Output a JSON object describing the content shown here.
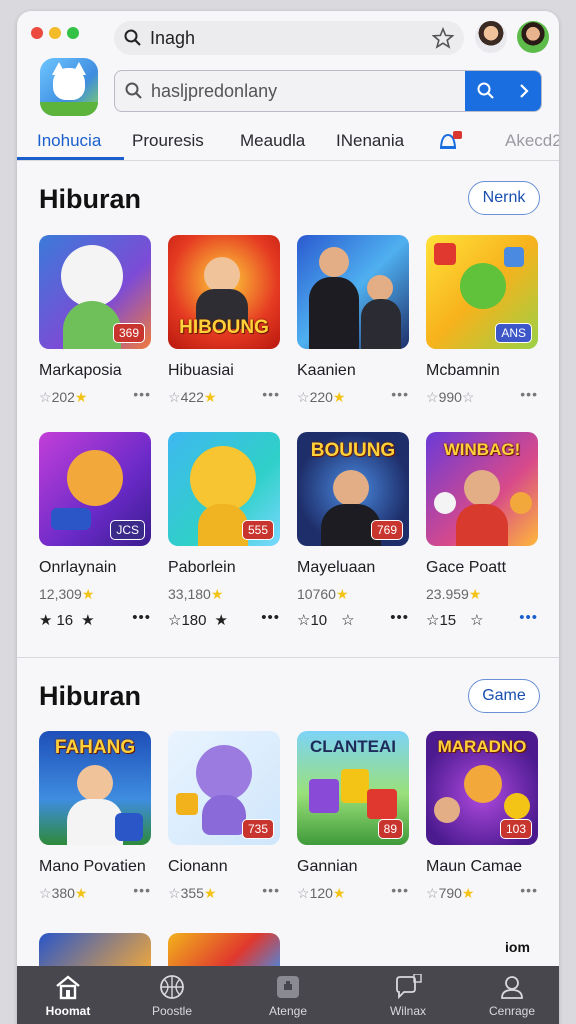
{
  "top": {
    "search_query": "Inagh",
    "main_search_placeholder": "hasljpredonlany"
  },
  "tabs": [
    {
      "label": "Inohucia",
      "active": true
    },
    {
      "label": "Prouresis"
    },
    {
      "label": "Meaudla"
    },
    {
      "label": "INenania"
    },
    {
      "label": "Akecd2",
      "faded": true
    }
  ],
  "sections": [
    {
      "title": "Hiburan",
      "action_label": "Nernk",
      "rows": [
        [
          {
            "name": "Markaposia",
            "rating": "202",
            "badge": "369"
          },
          {
            "name": "Hibuasiai",
            "rating": "422",
            "banner": "HIBOUNG"
          },
          {
            "name": "Kaanien",
            "rating": "220"
          },
          {
            "name": "Mcbamnin",
            "rating": "990",
            "badge": "ANS"
          }
        ],
        [
          {
            "name": "Onrlaynain",
            "rating": "12,309",
            "badge": "JCS",
            "sub": "16"
          },
          {
            "name": "Paborlein",
            "rating": "33,180",
            "badge": "555",
            "sub": "180"
          },
          {
            "name": "Mayeluaan",
            "rating": "10760",
            "badge": "769",
            "banner": "BOUUNG",
            "sub": "10"
          },
          {
            "name": "Gace Poatt",
            "rating": "23.959",
            "banner": "WINBAG!",
            "sub": "15"
          }
        ]
      ]
    },
    {
      "title": "Hiburan",
      "action_label": "Game",
      "rows": [
        [
          {
            "name": "Mano Povatien",
            "rating": "380",
            "banner": "FAHANG"
          },
          {
            "name": "Cionann",
            "rating": "355",
            "badge": "735"
          },
          {
            "name": "Gannian",
            "rating": "120",
            "banner": "CLANTEAI",
            "badge": "89"
          },
          {
            "name": "Maun Camae",
            "rating": "790",
            "banner": "MARADNO",
            "badge": "103"
          }
        ]
      ]
    }
  ],
  "footer_text": "iom",
  "bottom_nav": [
    {
      "label": "Hoomat",
      "icon": "home-icon",
      "active": true
    },
    {
      "label": "Poostle",
      "icon": "basketball-icon"
    },
    {
      "label": "Atenge",
      "icon": "store-icon"
    },
    {
      "label": "Wilnax",
      "icon": "chat-icon"
    },
    {
      "label": "Cenrage",
      "icon": "profile-icon"
    }
  ],
  "colors": {
    "accent": "#1a6ee0",
    "star": "#f3c316",
    "nav_bg": "#47474d"
  }
}
